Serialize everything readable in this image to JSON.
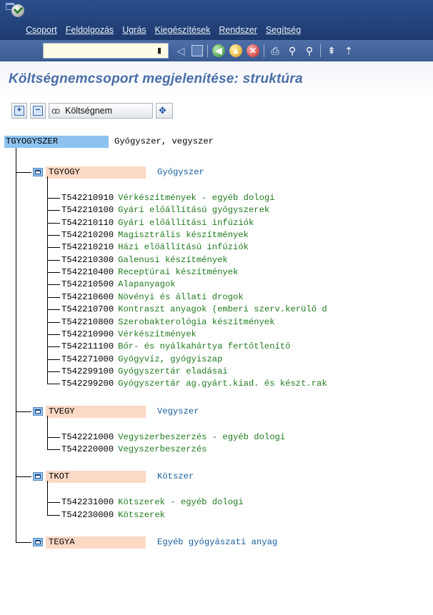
{
  "menu": {
    "items": [
      "Csoport",
      "Feldolgozás",
      "Ugrás",
      "Kiegészítések",
      "Rendszer",
      "Segítség"
    ]
  },
  "toolbar": {
    "command_field_value": "",
    "icons": [
      "enter-icon",
      "history-icon",
      "back-nav-icon",
      "save-icon",
      "back-icon",
      "exit-icon",
      "cancel-icon",
      "print-icon",
      "find-icon",
      "find-next-icon",
      "first-page-icon",
      "previous-page-icon"
    ]
  },
  "page": {
    "title": "Költségnemcsoport megjelenítése: struktúra"
  },
  "app_toolbar": {
    "cost_button_label": "Költségnem"
  },
  "tree": {
    "root": {
      "code": "TGYOGYSZER",
      "text": "Gyógyszer, vegyszer"
    },
    "groups": [
      {
        "code": "TGYOGY",
        "text": "Gyógyszer",
        "items": [
          {
            "code": "T542210910",
            "text": "Vérkészítmények - egyéb dologi"
          },
          {
            "code": "T542210100",
            "text": "Gyári előállítású gyógyszerek"
          },
          {
            "code": "T542210110",
            "text": "Gyári előállítási infúziók"
          },
          {
            "code": "T542210200",
            "text": "Magisztrális készítmények"
          },
          {
            "code": "T542210210",
            "text": "Házi előállítású infúziók"
          },
          {
            "code": "T542210300",
            "text": "Galenusi készítmények"
          },
          {
            "code": "T542210400",
            "text": "Receptúrai készítmények"
          },
          {
            "code": "T542210500",
            "text": "Alapanyagok"
          },
          {
            "code": "T542210600",
            "text": "Növényi és állati drogok"
          },
          {
            "code": "T542210700",
            "text": "Kontraszt anyagok (emberi szerv.kerülő d"
          },
          {
            "code": "T542210800",
            "text": "Szerobakterológia készítmények"
          },
          {
            "code": "T542210900",
            "text": "Vérkészítmények"
          },
          {
            "code": "T542211100",
            "text": "Bőr- és nyálkahártya fertőtlenítő"
          },
          {
            "code": "T542271000",
            "text": "Gyógyvíz, gyógyiszap"
          },
          {
            "code": "T542299100",
            "text": "Gyógyszertár eladásai"
          },
          {
            "code": "T542299200",
            "text": "Gyógyszertár ag.gyárt.kiad. és készt.rak"
          }
        ]
      },
      {
        "code": "TVEGY",
        "text": "Vegyszer",
        "items": [
          {
            "code": "T542221000",
            "text": "Vegyszerbeszerzés - egyéb dologi"
          },
          {
            "code": "T542220000",
            "text": "Vegyszerbeszerzés"
          }
        ]
      },
      {
        "code": "TKOT",
        "text": "Kötszer",
        "items": [
          {
            "code": "T542231000",
            "text": "Kötszerek - egyéb dologi"
          },
          {
            "code": "T542230000",
            "text": "Kötszerek"
          }
        ]
      },
      {
        "code": "TEGYA",
        "text": "Egyéb gyógyászati anyag",
        "items": []
      }
    ]
  }
}
